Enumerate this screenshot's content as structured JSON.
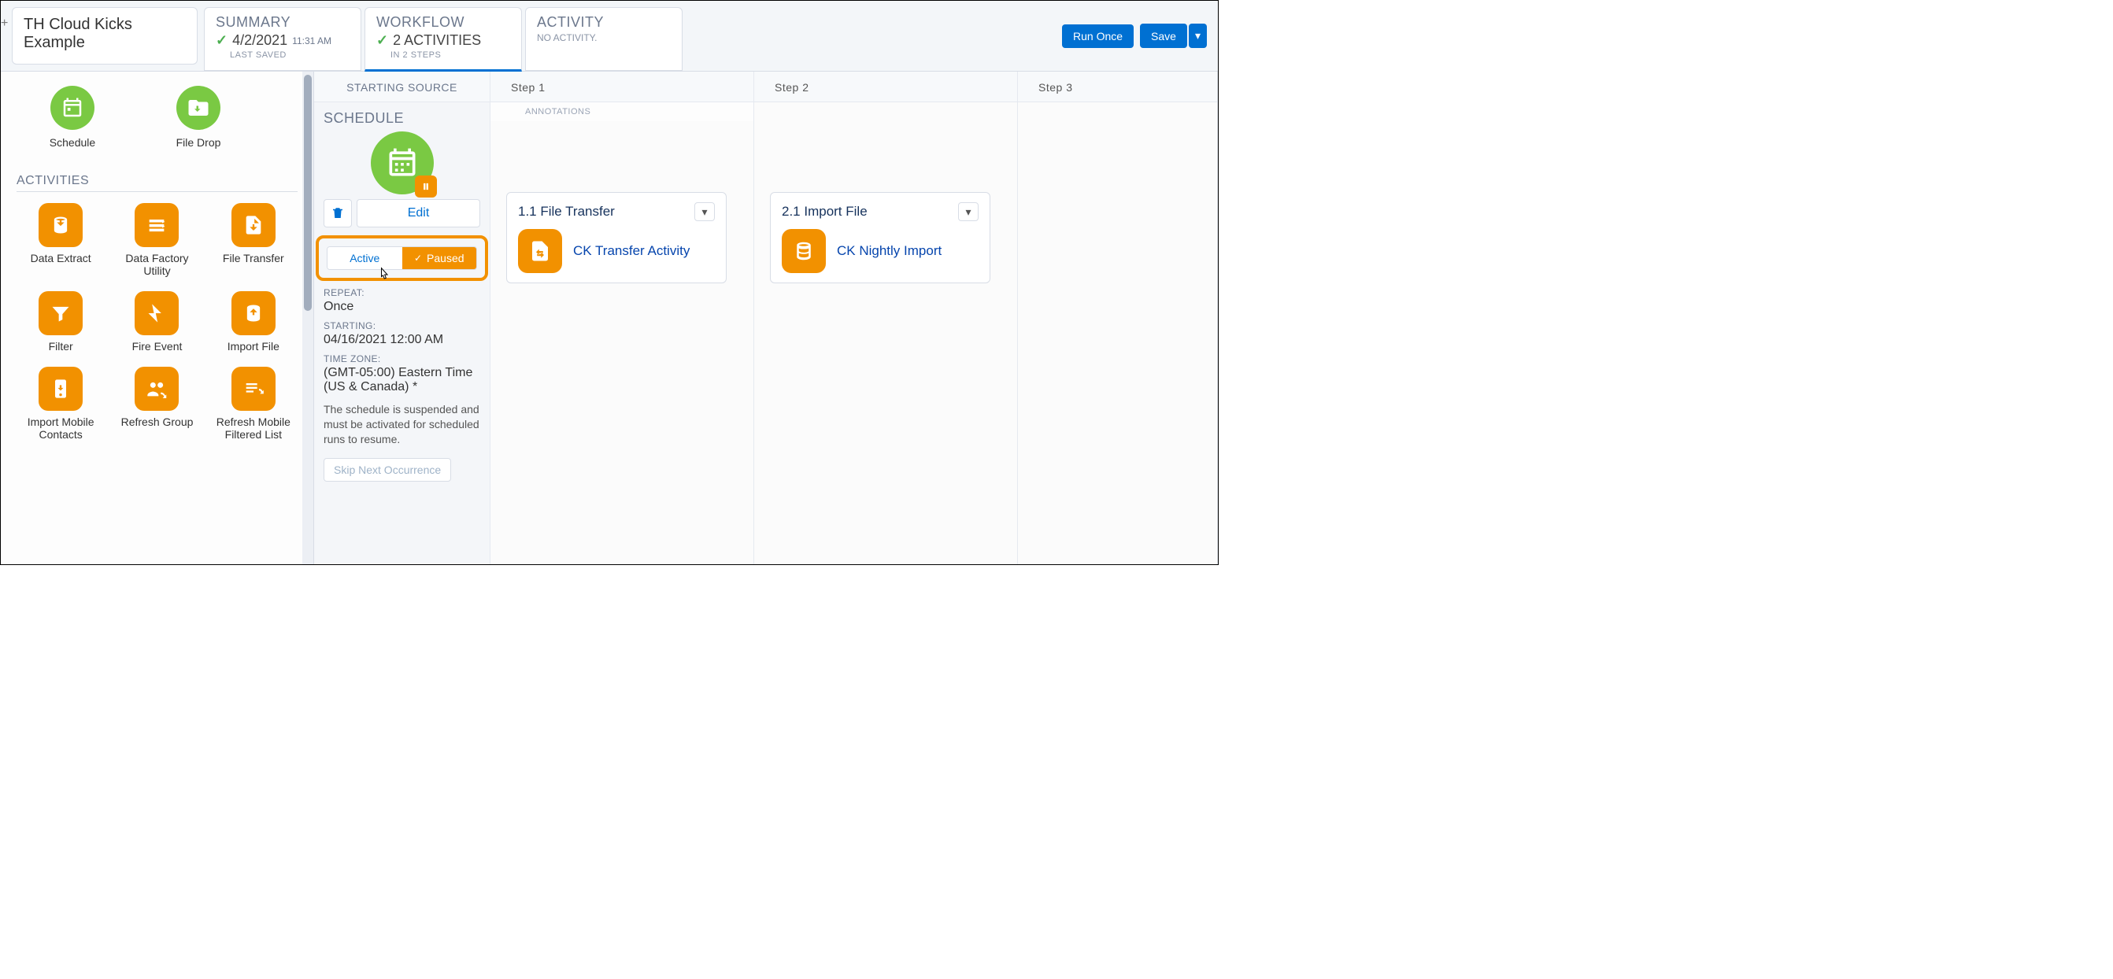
{
  "header": {
    "title": "TH Cloud Kicks Example",
    "summary": {
      "label": "SUMMARY",
      "date": "4/2/2021",
      "time": "11:31 AM",
      "sub": "LAST SAVED"
    },
    "workflow": {
      "label": "WORKFLOW",
      "count_line": "2 ACTIVITIES",
      "sub": "IN 2 STEPS"
    },
    "activity": {
      "label": "ACTIVITY",
      "sub": "NO ACTIVITY."
    },
    "run_once": "Run Once",
    "save": "Save"
  },
  "palette": {
    "starting_sources": [
      {
        "key": "schedule",
        "label": "Schedule"
      },
      {
        "key": "filedrop",
        "label": "File Drop"
      }
    ],
    "activities_label": "ACTIVITIES",
    "activities": [
      {
        "key": "data-extract",
        "label": "Data Extract"
      },
      {
        "key": "data-factory",
        "label": "Data Factory Utility"
      },
      {
        "key": "file-transfer",
        "label": "File Transfer"
      },
      {
        "key": "filter",
        "label": "Filter"
      },
      {
        "key": "fire-event",
        "label": "Fire Event"
      },
      {
        "key": "import-file",
        "label": "Import File"
      },
      {
        "key": "import-mobile",
        "label": "Import Mobile Contacts"
      },
      {
        "key": "refresh-group",
        "label": "Refresh Group"
      },
      {
        "key": "refresh-mobile",
        "label": "Refresh Mobile Filtered List"
      }
    ]
  },
  "canvas": {
    "starting_source_head": "STARTING SOURCE",
    "step1_head": "Step 1",
    "step2_head": "Step 2",
    "step3_head": "Step 3",
    "annotations": "ANNOTATIONS",
    "step1": {
      "title": "1.1 File Transfer",
      "name": "CK Transfer Activity"
    },
    "step2": {
      "title": "2.1 Import File",
      "name": "CK Nightly Import"
    }
  },
  "schedule": {
    "title": "SCHEDULE",
    "edit": "Edit",
    "active": "Active",
    "paused": "Paused",
    "repeat_k": "REPEAT:",
    "repeat_v": "Once",
    "starting_k": "STARTING:",
    "starting_v": "04/16/2021 12:00 AM",
    "tz_k": "TIME ZONE:",
    "tz_v": "(GMT-05:00) Eastern Time (US & Canada) *",
    "note": "The schedule is suspended and must be activated for scheduled runs to resume.",
    "skip": "Skip Next Occurrence"
  }
}
